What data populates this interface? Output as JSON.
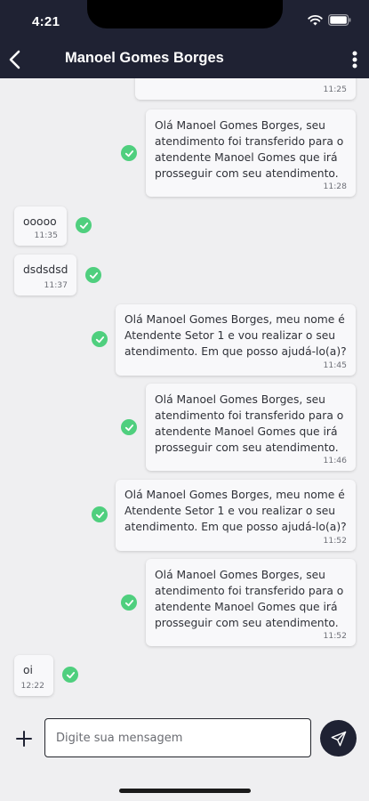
{
  "status_bar": {
    "time": "4:21"
  },
  "header": {
    "title": "Manoel Gomes Borges",
    "back_icon": "chevron-left-icon",
    "menu_icon": "more-vertical-icon"
  },
  "messages": [
    {
      "side": "right",
      "text": "",
      "time": "11:25"
    },
    {
      "side": "right",
      "text": "Olá Manoel Gomes Borges, seu\natendimento foi transferido para o\natendente Manoel Gomes que irá\nprosseguir com seu atendimento.",
      "time": "11:28"
    },
    {
      "side": "left",
      "text": "ooooo",
      "time": "11:35"
    },
    {
      "side": "left",
      "text": "dsdsdsd",
      "time": "11:37"
    },
    {
      "side": "right",
      "text": "Olá Manoel Gomes Borges, meu nome é\nAtendente Setor 1 e vou realizar o seu\natendimento. Em que posso ajudá-lo(a)?",
      "time": "11:45"
    },
    {
      "side": "right",
      "text": "Olá Manoel Gomes Borges, seu\natendimento foi transferido para o\natendente Manoel Gomes que irá\nprosseguir com seu atendimento.",
      "time": "11:46"
    },
    {
      "side": "right",
      "text": "Olá Manoel Gomes Borges, meu nome é\nAtendente Setor 1 e vou realizar o seu\natendimento. Em que posso ajudá-lo(a)?",
      "time": "11:52"
    },
    {
      "side": "right",
      "text": "Olá Manoel Gomes Borges, seu\natendimento foi transferido para o\natendente Manoel Gomes que irá\nprosseguir com seu atendimento.",
      "time": "11:52"
    },
    {
      "side": "left",
      "text": "oi",
      "time": "12:22"
    }
  ],
  "composer": {
    "placeholder": "Digite sua mensagem",
    "value": "",
    "plus_icon": "plus-icon",
    "send_icon": "send-icon"
  },
  "colors": {
    "header": "#1f2233",
    "check": "#4fcf7e",
    "background": "#efeff1",
    "bubble": "#f8f8fa"
  }
}
